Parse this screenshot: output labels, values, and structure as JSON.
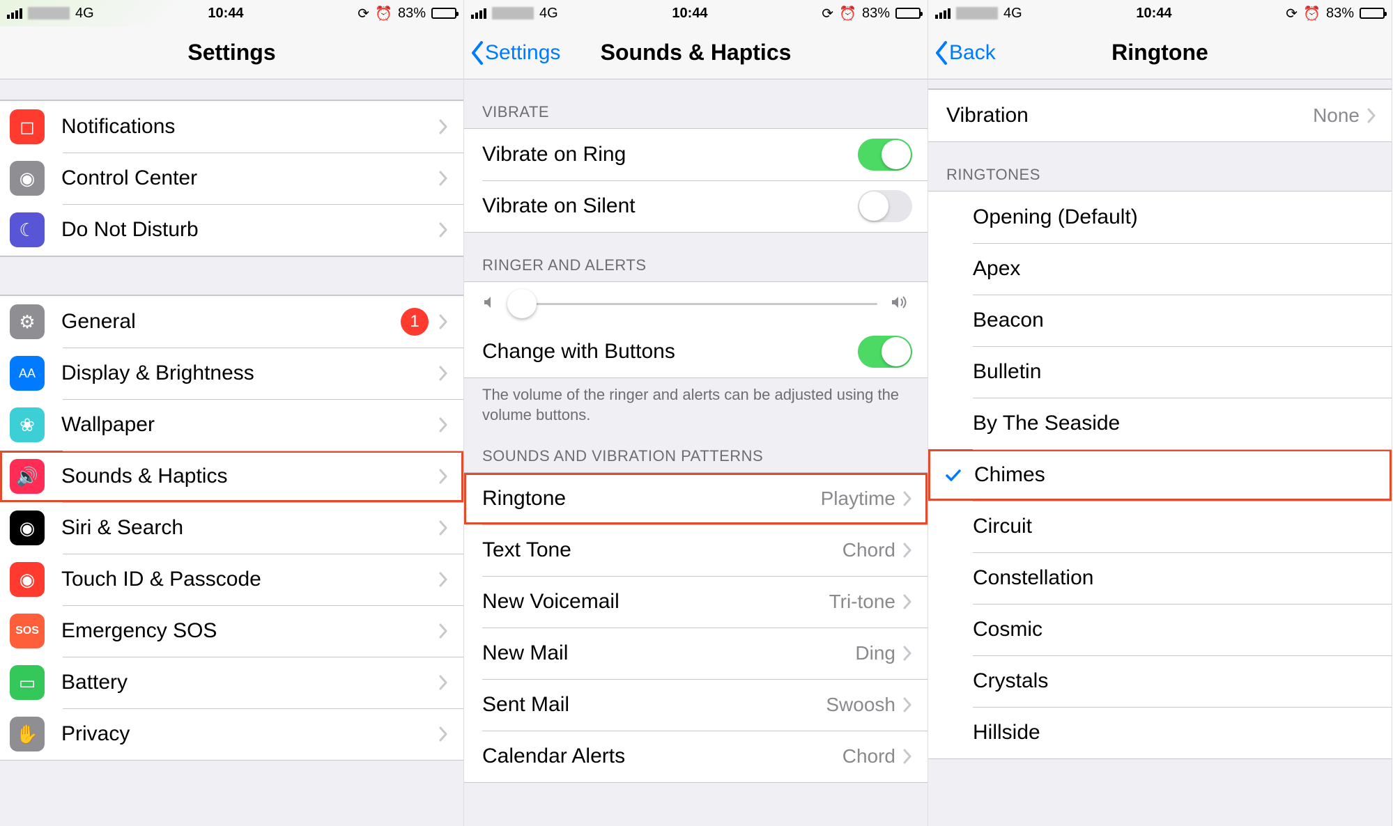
{
  "statusbar": {
    "network": "4G",
    "time": "10:44",
    "battery_pct": "83%"
  },
  "screen1": {
    "title": "Settings",
    "group1": [
      {
        "label": "Notifications"
      },
      {
        "label": "Control Center"
      },
      {
        "label": "Do Not Disturb"
      }
    ],
    "group2": [
      {
        "label": "General",
        "badge": "1"
      },
      {
        "label": "Display & Brightness"
      },
      {
        "label": "Wallpaper"
      },
      {
        "label": "Sounds & Haptics",
        "highlighted": true
      },
      {
        "label": "Siri & Search"
      },
      {
        "label": "Touch ID & Passcode"
      },
      {
        "label": "Emergency SOS"
      },
      {
        "label": "Battery"
      },
      {
        "label": "Privacy"
      }
    ]
  },
  "screen2": {
    "back": "Settings",
    "title": "Sounds & Haptics",
    "sec_vibrate": "VIBRATE",
    "vibrate_ring": "Vibrate on Ring",
    "vibrate_silent": "Vibrate on Silent",
    "sec_ringer": "RINGER AND ALERTS",
    "change_buttons": "Change with Buttons",
    "footer": "The volume of the ringer and alerts can be adjusted using the volume buttons.",
    "sec_sounds": "SOUNDS AND VIBRATION PATTERNS",
    "sounds": [
      {
        "label": "Ringtone",
        "value": "Playtime",
        "highlighted": true
      },
      {
        "label": "Text Tone",
        "value": "Chord"
      },
      {
        "label": "New Voicemail",
        "value": "Tri-tone"
      },
      {
        "label": "New Mail",
        "value": "Ding"
      },
      {
        "label": "Sent Mail",
        "value": "Swoosh"
      },
      {
        "label": "Calendar Alerts",
        "value": "Chord"
      }
    ]
  },
  "screen3": {
    "back": "Back",
    "title": "Ringtone",
    "vibration_label": "Vibration",
    "vibration_value": "None",
    "sec_ringtones": "RINGTONES",
    "ringtones": [
      {
        "name": "Opening (Default)"
      },
      {
        "name": "Apex"
      },
      {
        "name": "Beacon"
      },
      {
        "name": "Bulletin"
      },
      {
        "name": "By The Seaside"
      },
      {
        "name": "Chimes",
        "selected": true,
        "highlighted": true
      },
      {
        "name": "Circuit"
      },
      {
        "name": "Constellation"
      },
      {
        "name": "Cosmic"
      },
      {
        "name": "Crystals"
      },
      {
        "name": "Hillside"
      }
    ]
  }
}
